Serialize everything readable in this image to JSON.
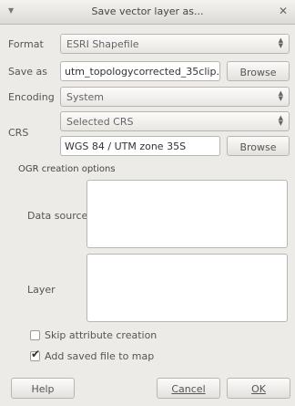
{
  "window": {
    "title": "Save vector layer as...",
    "menu_icon": "chevron-down-icon",
    "close_icon": "close-icon"
  },
  "form": {
    "format_label": "Format",
    "format_value": "ESRI Shapefile",
    "save_as_label": "Save as",
    "save_as_value": "utm_topologycorrected_35clip.shp",
    "browse_label": "Browse",
    "encoding_label": "Encoding",
    "encoding_value": "System",
    "crs_label": "CRS",
    "crs_mode_value": "Selected CRS",
    "crs_value": "WGS 84 / UTM zone 35S",
    "crs_browse_label": "Browse"
  },
  "ogr": {
    "group_title": "OGR creation options",
    "data_source_label": "Data source",
    "layer_label": "Layer"
  },
  "options": {
    "skip_attribute_label": "Skip attribute creation",
    "skip_attribute_checked": false,
    "add_to_map_label": "Add saved file to map",
    "add_to_map_checked": true
  },
  "buttons": {
    "help_label": "Help",
    "cancel_label": "Cancel",
    "ok_label": "OK"
  }
}
